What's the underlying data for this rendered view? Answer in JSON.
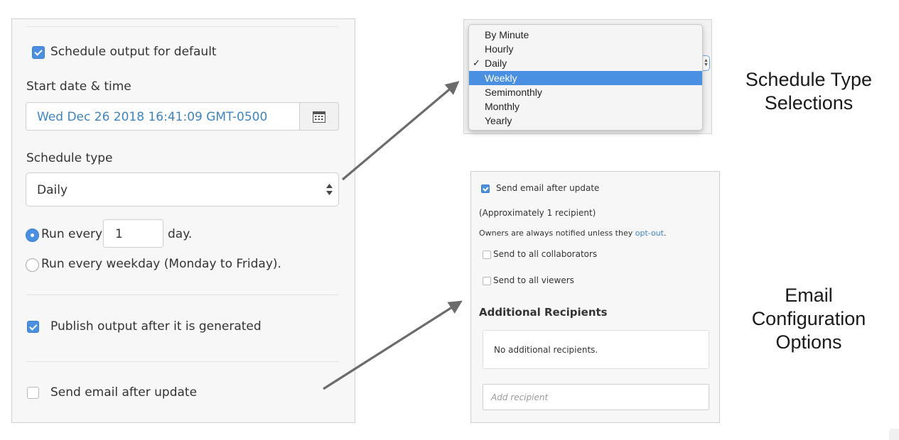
{
  "schedule_panel": {
    "schedule_output_label": "Schedule output for default",
    "schedule_output_checked": true,
    "start_label": "Start date & time",
    "start_value": "Wed Dec 26 2018 16:41:09 GMT-0500",
    "type_label": "Schedule type",
    "type_value": "Daily",
    "run_every_prefix": "Run every",
    "run_every_value": "1",
    "run_every_suffix": "day.",
    "run_weekday_label": "Run every weekday (Monday to Friday).",
    "publish_label": "Publish output after it is generated",
    "publish_checked": true,
    "send_email_label": "Send email after update",
    "send_email_checked": false
  },
  "schedule_type_dropdown": {
    "options": [
      "By Minute",
      "Hourly",
      "Daily",
      "Weekly",
      "Semimonthly",
      "Monthly",
      "Yearly"
    ],
    "checked": "Daily",
    "highlighted": "Weekly",
    "check_glyph": "✓"
  },
  "email_panel": {
    "send_email_label": "Send email after update",
    "recipient_count": "(Approximately 1 recipient)",
    "owners_note": "Owners are always notified unless they",
    "owners_link": "opt-out",
    "owners_tail": ".",
    "collaborators_label": "Send to all collaborators",
    "viewers_label": "Send to all viewers",
    "additional_heading": "Additional Recipients",
    "no_recipients": "No additional recipients.",
    "add_recipient_placeholder": "Add recipient"
  },
  "captions": {
    "schedule_line1": "Schedule Type",
    "schedule_line2": "Selections",
    "email_line1": "Email",
    "email_line2": "Configuration",
    "email_line3": "Options"
  },
  "colors": {
    "accent": "#4a90e2",
    "value_text": "#3d85c6",
    "arrow": "#6b6b6b"
  }
}
